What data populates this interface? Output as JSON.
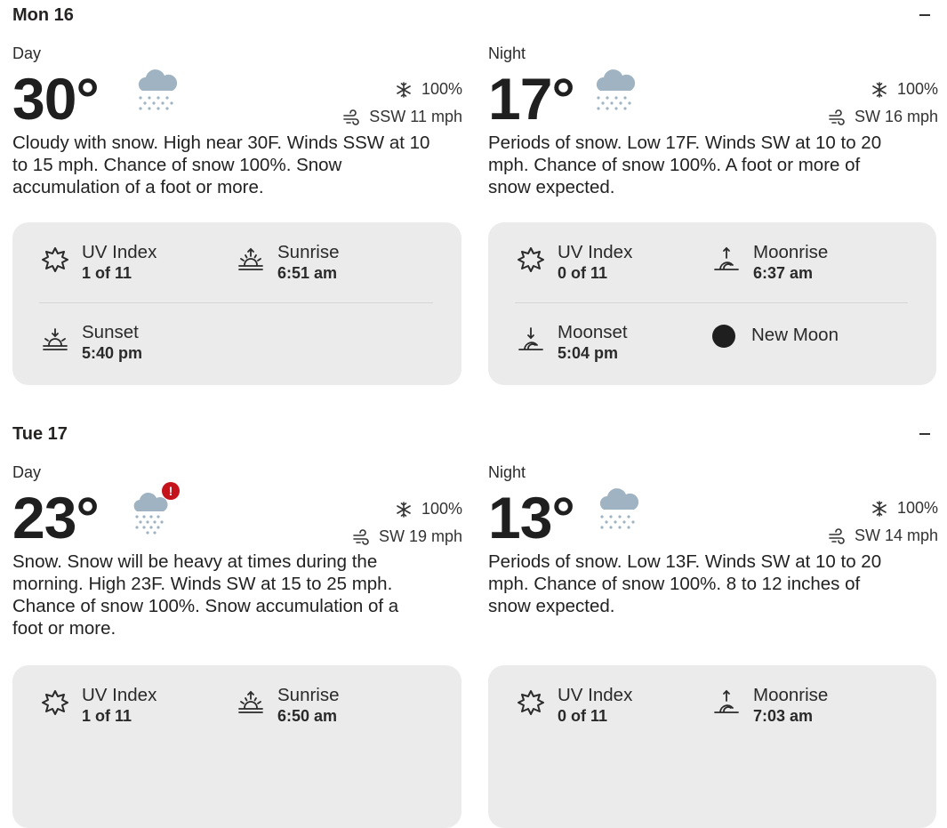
{
  "days": [
    {
      "header": "Mon 16",
      "day": {
        "label": "Day",
        "temp": "30°",
        "precip": "100%",
        "wind": "SSW 11 mph",
        "icon": "snow-cloud-icon",
        "narrative": "Cloudy with snow. High near 30F. Winds SSW at 10 to 15 mph. Chance of snow 100%. Snow accumulation of a foot or more.",
        "uv_label": "UV Index",
        "uv_value": "1 of 11",
        "sunrise_label": "Sunrise",
        "sunrise_value": "6:51 am",
        "sunset_label": "Sunset",
        "sunset_value": "5:40 pm"
      },
      "night": {
        "label": "Night",
        "temp": "17°",
        "precip": "100%",
        "wind": "SW 16 mph",
        "icon": "snow-cloud-icon",
        "narrative": "Periods of snow. Low 17F. Winds SW at 10 to 20 mph. Chance of snow 100%. A foot or more of snow expected.",
        "uv_label": "UV Index",
        "uv_value": "0 of 11",
        "moonrise_label": "Moonrise",
        "moonrise_value": "6:37 am",
        "moonset_label": "Moonset",
        "moonset_value": "5:04 pm",
        "moon_phase": "New Moon"
      }
    },
    {
      "header": "Tue 17",
      "day": {
        "label": "Day",
        "temp": "23°",
        "precip": "100%",
        "wind": "SW 19 mph",
        "icon": "heavy-snow-cloud-icon",
        "alert": "!",
        "narrative": "Snow. Snow will be heavy at times during the morning. High 23F. Winds SW at 15 to 25 mph. Chance of snow 100%. Snow accumulation of a foot or more.",
        "uv_label": "UV Index",
        "uv_value": "1 of 11",
        "sunrise_label": "Sunrise",
        "sunrise_value": "6:50 am"
      },
      "night": {
        "label": "Night",
        "temp": "13°",
        "precip": "100%",
        "wind": "SW 14 mph",
        "icon": "snow-cloud-icon",
        "narrative": "Periods of snow. Low 13F. Winds SW at 10 to 20 mph. Chance of snow 100%. 8 to 12 inches of snow expected.",
        "uv_label": "UV Index",
        "uv_value": "0 of 11",
        "moonrise_label": "Moonrise",
        "moonrise_value": "7:03 am"
      }
    }
  ],
  "colors": {
    "card_bg": "#ebebeb",
    "cloud": "#9fb3c2",
    "alert": "#c4131b",
    "text": "#252422"
  }
}
